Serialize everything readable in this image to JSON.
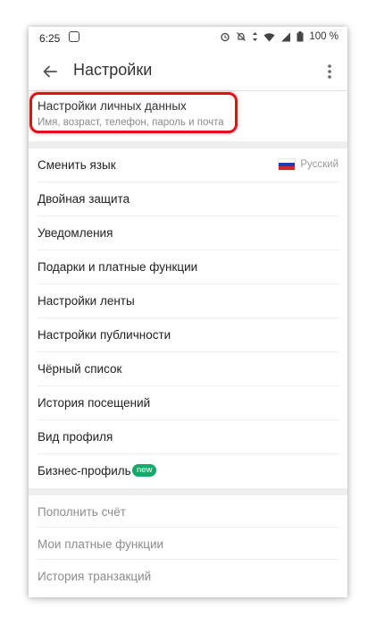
{
  "status": {
    "time": "6:25",
    "battery": "100 %"
  },
  "appbar": {
    "title": "Настройки"
  },
  "personal": {
    "title": "Настройки личных данных",
    "subtitle": "Имя, возраст, телефон, пароль и почта"
  },
  "menu": {
    "language_label": "Сменить язык",
    "language_value": "Русский",
    "items": [
      "Двойная защита",
      "Уведомления",
      "Подарки и платные функции",
      "Настройки ленты",
      "Настройки публичности",
      "Чёрный список",
      "История посещений",
      "Вид профиля"
    ],
    "business_label": "Бизнес-профиль",
    "business_badge": "new"
  },
  "secondary": {
    "items": [
      "Пополнить счёт",
      "Мои платные функции",
      "История транзакций"
    ]
  },
  "colors": {
    "highlight": "#e0111b",
    "badge": "#1aa76b"
  },
  "icons": {
    "back": "arrow-back-icon",
    "overflow": "more-vert-icon"
  }
}
